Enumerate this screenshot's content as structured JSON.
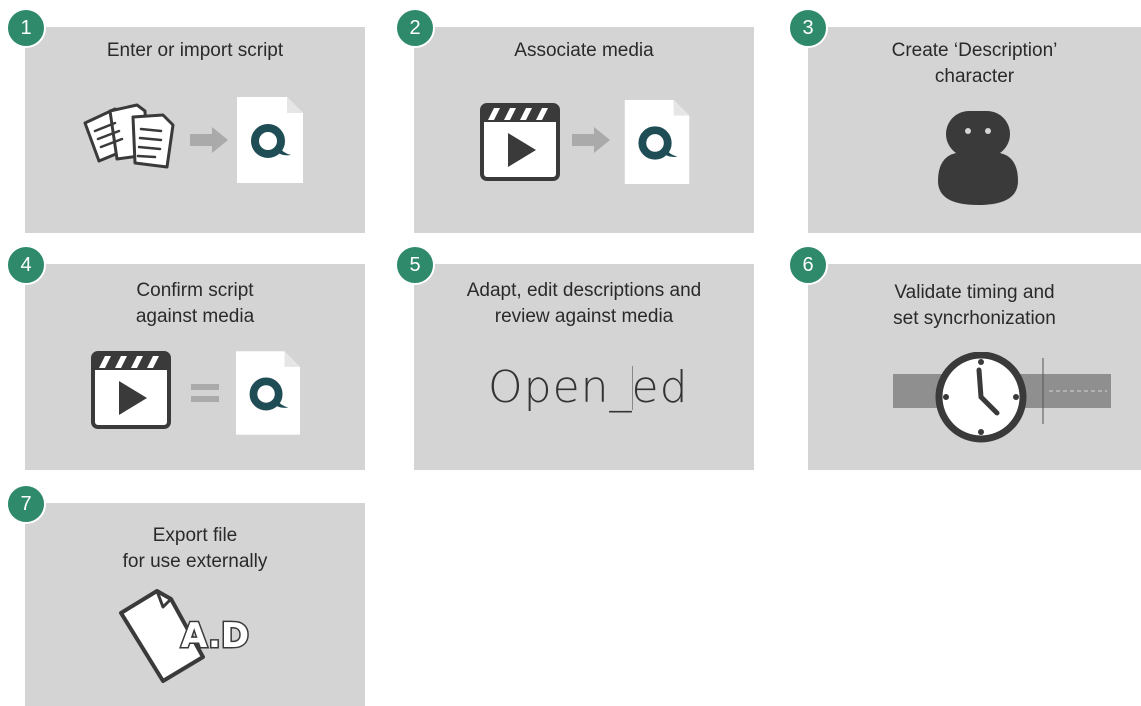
{
  "colors": {
    "badge": "#2e8a6a",
    "card": "#d3d4d3",
    "icon_dark": "#3a3a3a",
    "arrow": "#a9aaa9",
    "logo": "#1f4d55"
  },
  "steps": [
    {
      "number": "1",
      "title_lines": [
        "Enter or import script"
      ],
      "icons": [
        "documents-icon",
        "arrow-right-icon",
        "script-file-logo-icon"
      ]
    },
    {
      "number": "2",
      "title_lines": [
        "Associate media"
      ],
      "icons": [
        "video-clapper-icon",
        "arrow-right-icon",
        "script-file-logo-icon"
      ]
    },
    {
      "number": "3",
      "title_lines": [
        "Create ‘Description’",
        "character"
      ],
      "icons": [
        "character-avatar-icon"
      ]
    },
    {
      "number": "4",
      "title_lines": [
        "Confirm script",
        "against media"
      ],
      "icons": [
        "video-clapper-icon",
        "equals-icon",
        "script-file-logo-icon"
      ]
    },
    {
      "number": "5",
      "title_lines": [
        "Adapt, edit descriptions and",
        "review against media"
      ],
      "typed_text": {
        "before": "Open_",
        "after": "ed"
      }
    },
    {
      "number": "6",
      "title_lines": [
        "Validate timing and",
        "set syncrhonization"
      ],
      "icons": [
        "clock-timeline-icon"
      ]
    },
    {
      "number": "7",
      "title_lines": [
        "Export file",
        "for use externally"
      ],
      "icons": [
        "export-file-icon"
      ],
      "file_label": "A.D"
    }
  ]
}
